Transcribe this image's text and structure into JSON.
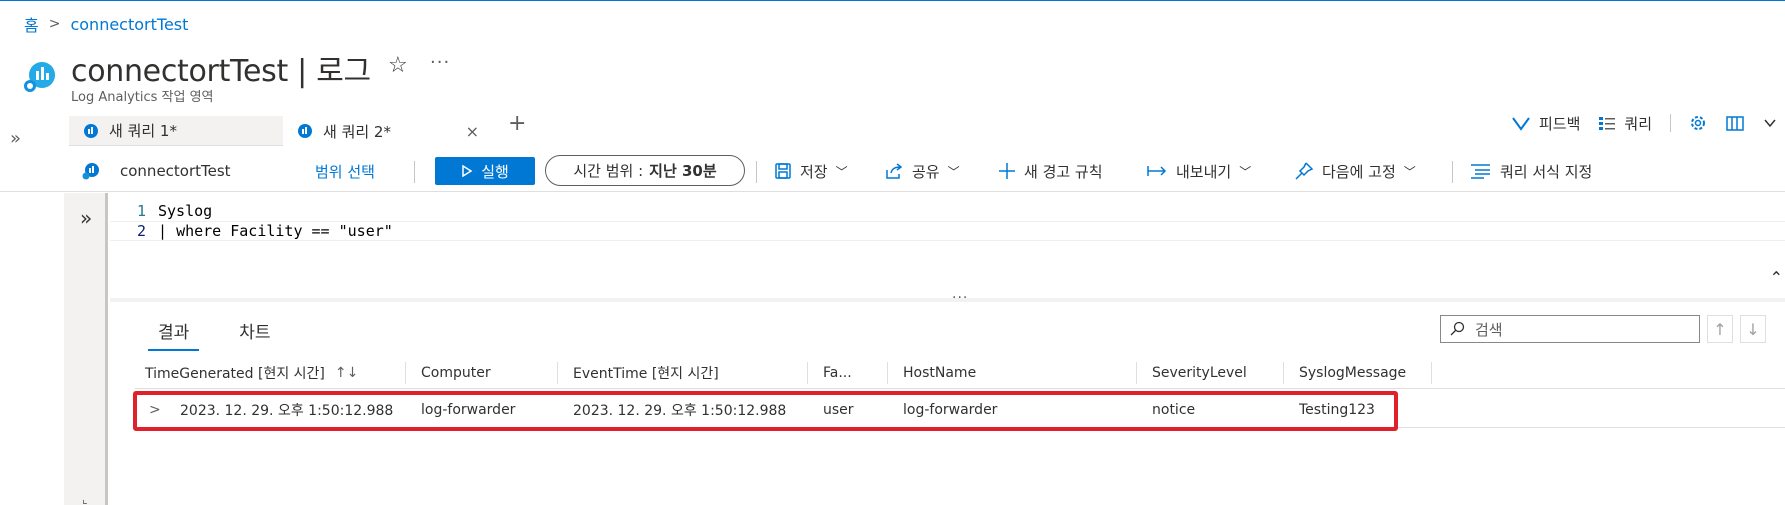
{
  "breadcrumb": {
    "home": "홈",
    "separator": ">",
    "current": "connectortTest"
  },
  "header": {
    "title": "connectortTest | 로그",
    "subtitle": "Log Analytics 작업 영역",
    "star_icon": "☆",
    "more_icon": "···"
  },
  "left_nav": {
    "expand_icon": "»"
  },
  "query_tabs": [
    {
      "label": "새 쿼리 1*",
      "active": false
    },
    {
      "label": "새 쿼리 2*",
      "active": true,
      "close": "×"
    }
  ],
  "add_tab_icon": "+",
  "right_tools": {
    "feedback": "피드백",
    "queries": "쿼리"
  },
  "toolbar": {
    "scope": "connectortTest",
    "scope_select": "범위 선택",
    "run": "실행",
    "time_range_label": "시간 범위 :",
    "time_range_value": "지난 30분",
    "save": "저장",
    "share": "공유",
    "new_alert": "새 경고 규칙",
    "export": "내보내기",
    "pin": "다음에 고정",
    "format": "쿼리 서식 지정"
  },
  "editor": {
    "lines": [
      {
        "number": "1",
        "text": "Syslog"
      },
      {
        "number": "2",
        "pipe": "| ",
        "keyword": "where",
        "text": " Facility == ",
        "string": "\"user\""
      }
    ],
    "splitter_dots": "···"
  },
  "results": {
    "tabs": [
      {
        "label": "결과",
        "active": true
      },
      {
        "label": "차트",
        "active": false
      }
    ],
    "search_placeholder": "검색",
    "columns": [
      "TimeGenerated [현지 시간]",
      "Computer",
      "EventTime [현지 시간]",
      "Fa...",
      "HostName",
      "SeverityLevel",
      "SyslogMessage"
    ],
    "sort_icon": "↑↓",
    "rows": [
      {
        "expand": ">",
        "cells": [
          "2023. 12. 29. 오후 1:50:12.988",
          "log-forwarder",
          "2023. 12. 29. 오후 1:50:12.988",
          "user",
          "log-forwarder",
          "notice",
          "Testing123"
        ]
      }
    ]
  },
  "colors": {
    "accent": "#0078d4",
    "highlight": "#e0202b"
  }
}
